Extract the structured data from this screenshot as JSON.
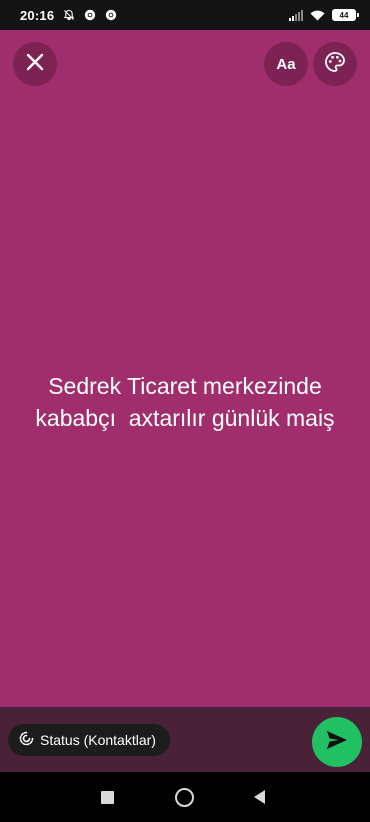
{
  "status_bar": {
    "time": "20:16",
    "battery": "44",
    "icons": [
      "notifications-off-icon",
      "chrome-icon",
      "chrome-icon",
      "signal-icon",
      "wifi-icon",
      "battery-icon"
    ]
  },
  "toolbar": {
    "close_icon": "close-icon",
    "font_label": "Aa",
    "palette_icon": "palette-icon"
  },
  "status_text": "Sedrek Ticaret merkezinde\nkababçı  axtarılır günlük maiş",
  "bottom": {
    "audience_label": "Status (Kontaktlar)",
    "send_icon": "send-icon"
  },
  "colors": {
    "background": "#a02d6c",
    "send_button": "#21c063",
    "bottom_bar": "#4a2238"
  }
}
